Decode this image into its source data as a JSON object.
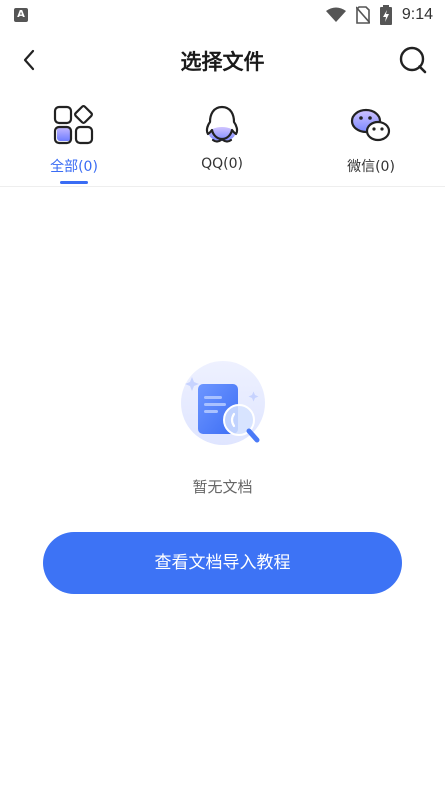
{
  "status_bar": {
    "app_icon_letter": "A",
    "time": "9:14",
    "icons": [
      "wifi-icon",
      "no-sim-icon",
      "battery-charging-icon"
    ]
  },
  "header": {
    "title": "选择文件",
    "back_icon": "chevron-left-icon",
    "search_icon": "search-icon"
  },
  "tabs": [
    {
      "label": "全部(0)",
      "icon": "grid-apps-icon",
      "active": true
    },
    {
      "label": "QQ(0)",
      "icon": "qq-penguin-icon",
      "active": false
    },
    {
      "label": "微信(0)",
      "icon": "wechat-icon",
      "active": false
    }
  ],
  "empty_state": {
    "text": "暂无文档",
    "icon": "document-search-illustration"
  },
  "guide_button": {
    "label": "查看文档导入教程"
  },
  "colors": {
    "accent": "#3a6cf4",
    "button": "#3d73f5",
    "icon_tint": "#8e9cff"
  }
}
